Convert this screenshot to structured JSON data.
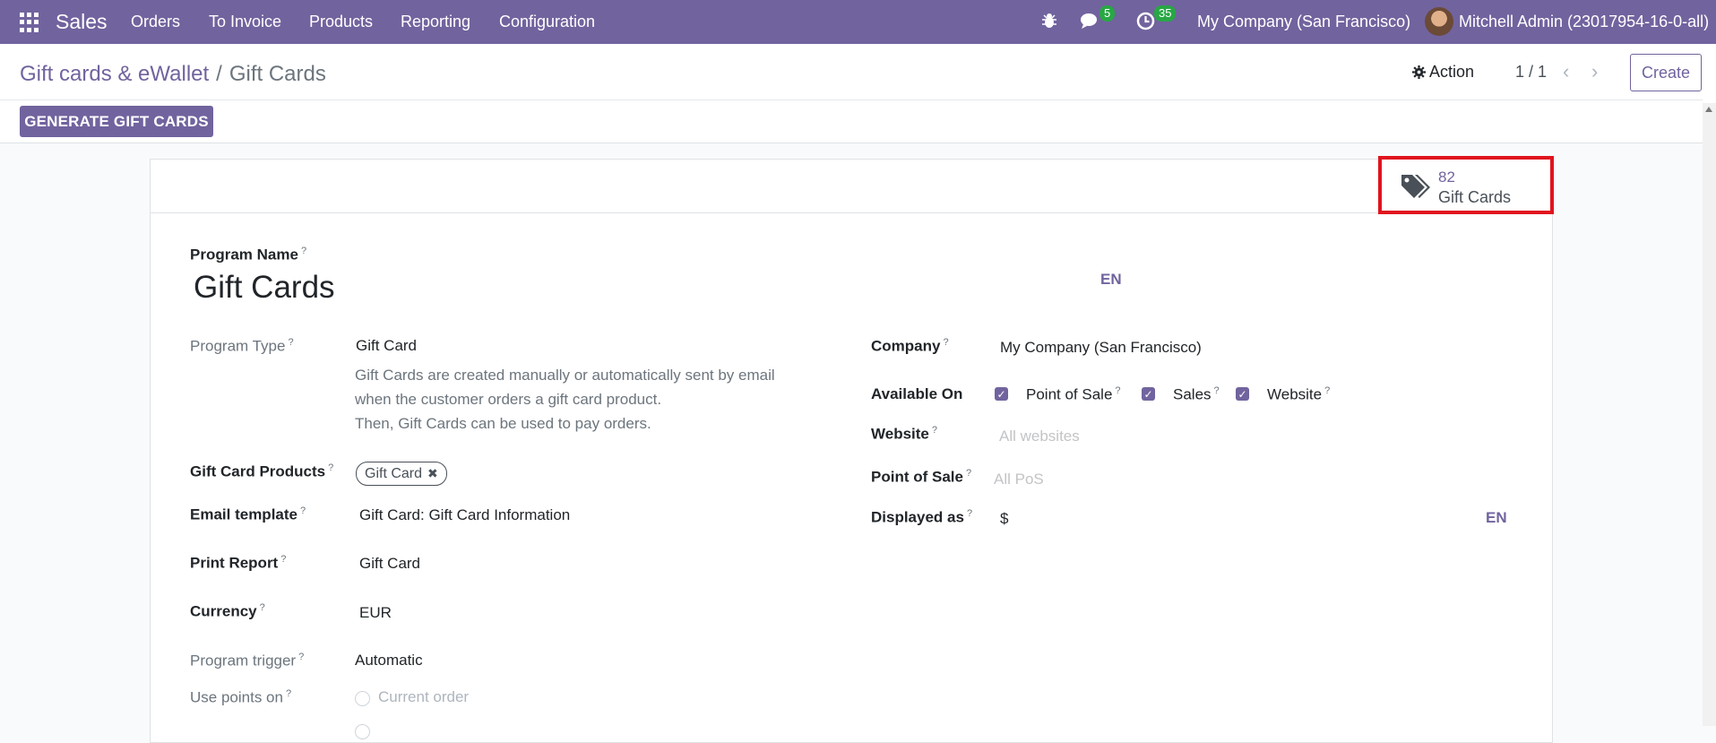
{
  "navbar": {
    "brand": "Sales",
    "menu": [
      "Orders",
      "To Invoice",
      "Products",
      "Reporting",
      "Configuration"
    ],
    "messages_count": "5",
    "activities_count": "35",
    "company": "My Company (San Francisco)",
    "user": "Mitchell Admin (23017954-16-0-all)"
  },
  "breadcrumb": {
    "parent": "Gift cards & eWallet",
    "separator": "/",
    "current": "Gift Cards"
  },
  "control": {
    "action_label": "Action",
    "pager": "1 / 1",
    "create_label": "Create",
    "generate_label": "GENERATE GIFT CARDS"
  },
  "stat": {
    "value": "82",
    "label": "Gift Cards"
  },
  "form": {
    "program_name_label": "Program Name",
    "program_name": "Gift Cards",
    "lang": "EN",
    "program_type_label": "Program Type",
    "program_type": "Gift Card",
    "help_lines": [
      "Gift Cards are created manually or automatically sent by email",
      "when the customer orders a gift card product.",
      "Then, Gift Cards can be used to pay orders."
    ],
    "products_label": "Gift Card Products",
    "product_tag": "Gift Card",
    "email_label": "Email template",
    "email_value": "Gift Card: Gift Card Information",
    "print_label": "Print Report",
    "print_value": "Gift Card",
    "currency_label": "Currency",
    "currency_value": "EUR",
    "trigger_label": "Program trigger",
    "trigger_value": "Automatic",
    "use_points_label": "Use points on",
    "use_points_option": "Current order",
    "company_label": "Company",
    "company_value": "My Company (San Francisco)",
    "available_label": "Available On",
    "available_options": [
      "Point of Sale",
      "Sales",
      "Website"
    ],
    "website_label": "Website",
    "website_placeholder": "All websites",
    "pos_label": "Point of Sale",
    "pos_placeholder": "All PoS",
    "displayed_label": "Displayed as",
    "displayed_value": "$",
    "displayed_lang": "EN",
    "help_mark": "?"
  }
}
